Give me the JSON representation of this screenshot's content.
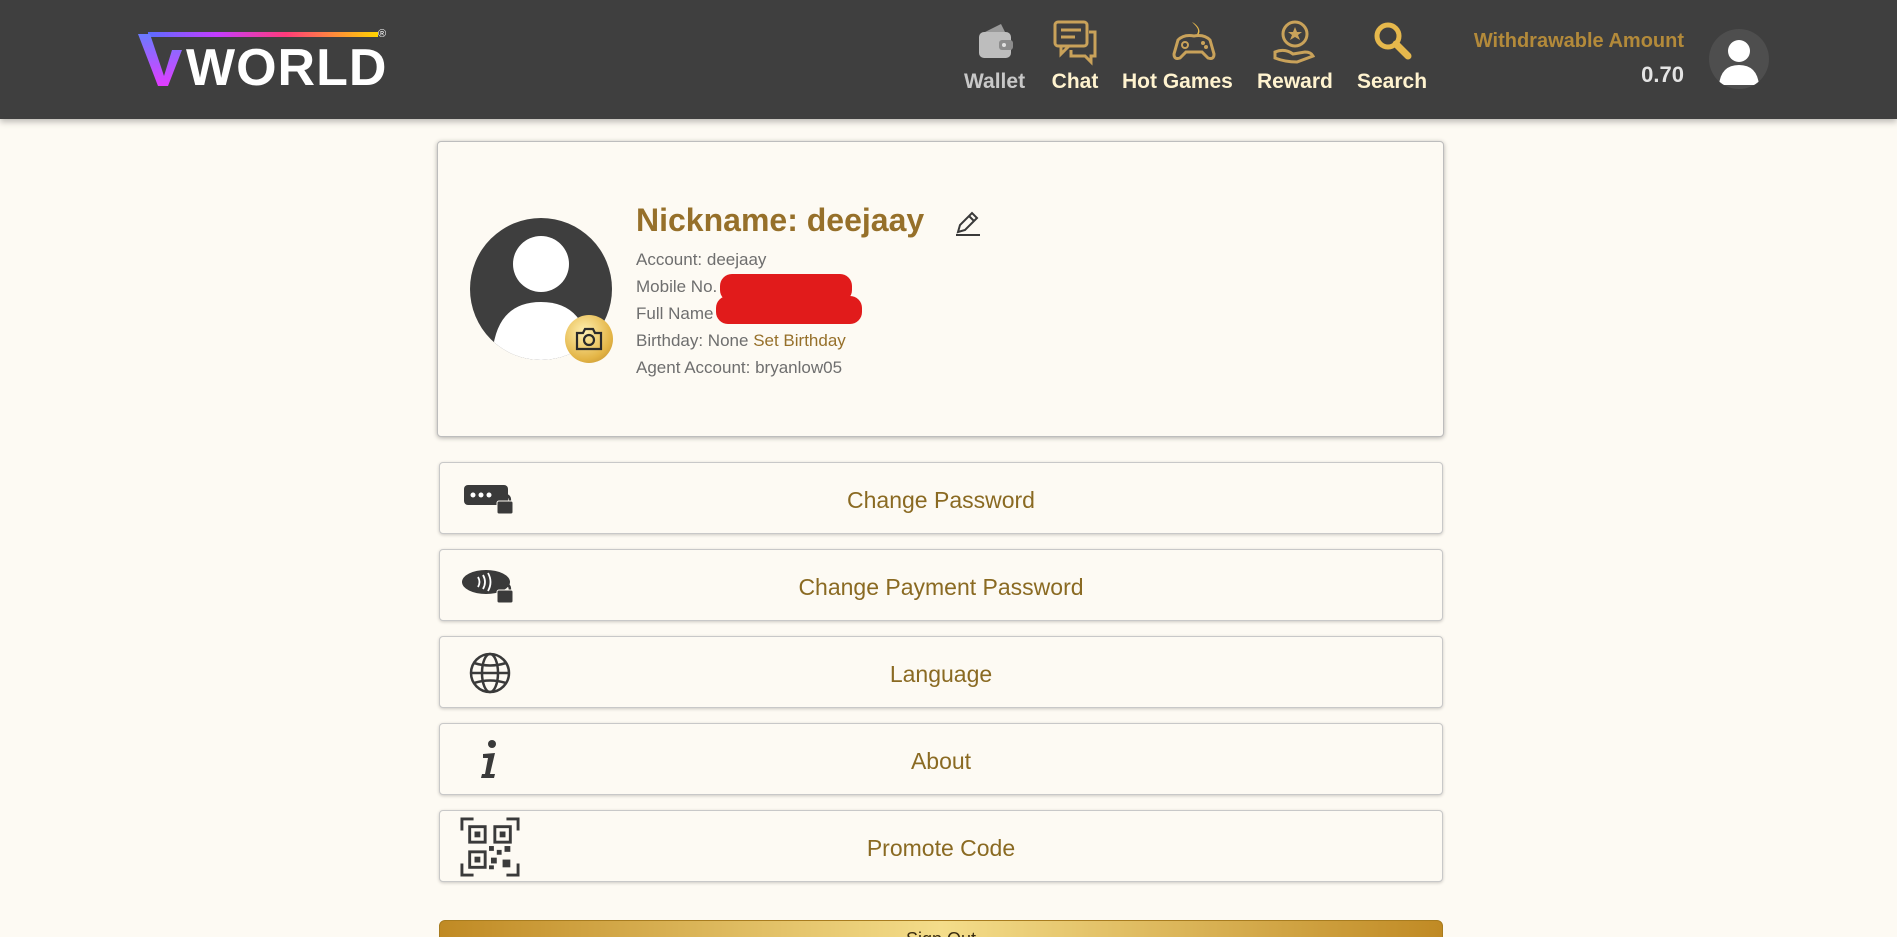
{
  "brand": {
    "logo_text": "WORLD",
    "logo_mark": "V",
    "registered": "®"
  },
  "nav": [
    {
      "label": "Wallet",
      "icon": "wallet-icon"
    },
    {
      "label": "Chat",
      "icon": "chat-icon"
    },
    {
      "label": "Hot Games",
      "icon": "gamepad-icon"
    },
    {
      "label": "Reward",
      "icon": "reward-icon"
    },
    {
      "label": "Search",
      "icon": "search-icon"
    }
  ],
  "withdrawable": {
    "label": "Withdrawable Amount",
    "value": "0.70"
  },
  "profile": {
    "nickname": "Nickname: deejaay",
    "account": "Account: deejaay",
    "mobile_label": "Mobile No.",
    "fullname_label": "Full Name",
    "birthday": "Birthday: None",
    "set_birthday": "Set Birthday",
    "agent": "Agent Account: bryanlow05"
  },
  "menu": [
    {
      "label": "Change Password",
      "icon": "password-lock-icon"
    },
    {
      "label": "Change Payment Password",
      "icon": "payment-lock-icon"
    },
    {
      "label": "Language",
      "icon": "globe-icon"
    },
    {
      "label": "About",
      "icon": "info-icon"
    },
    {
      "label": "Promote Code",
      "icon": "qr-code-icon"
    }
  ],
  "signout_label": "Sign Out",
  "colors": {
    "header": "#3f3f3f",
    "accent": "#96702a",
    "background": "#fdfaf3"
  }
}
